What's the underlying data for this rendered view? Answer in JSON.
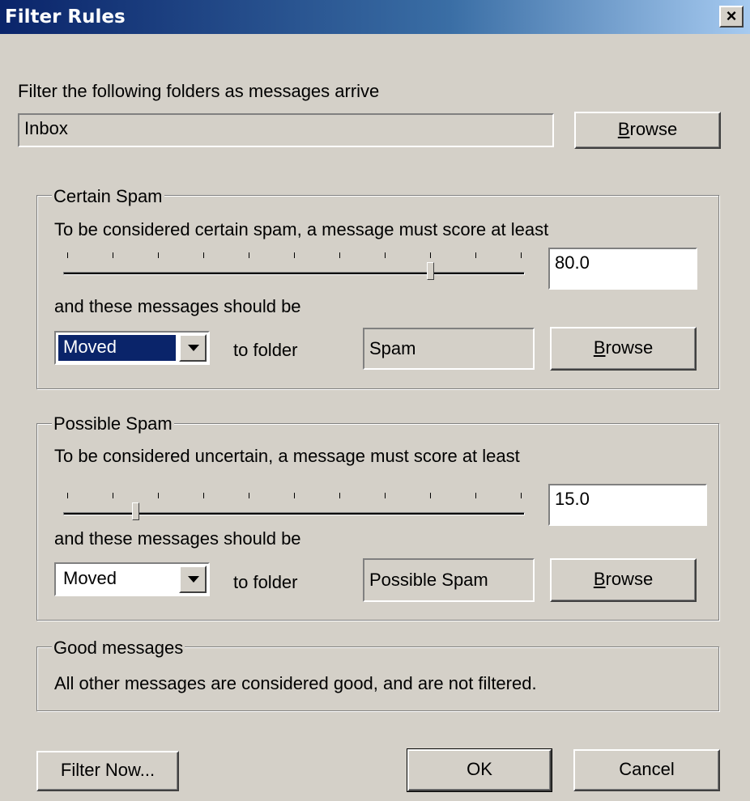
{
  "window": {
    "title": "Filter Rules",
    "close_label": "×"
  },
  "folders": {
    "instruction": "Filter the following folders as messages arrive",
    "value": "Inbox",
    "browse": {
      "prefix": "",
      "accel": "B",
      "rest": "rowse"
    }
  },
  "certain": {
    "group_label": "Certain Spam",
    "instruction": "To be considered certain spam, a message must score at least",
    "score": "80.0",
    "slider_level_percent": 80,
    "messages_label": "and these messages should be",
    "action": "Moved",
    "to_folder_label": "to folder",
    "folder": "Spam",
    "browse": {
      "accel": "B",
      "rest": "rowse"
    }
  },
  "possible": {
    "group_label": "Possible Spam",
    "instruction": "To be considered uncertain, a message must score at least",
    "score": "15.0",
    "slider_level_percent": 15,
    "messages_label": "and these messages should be",
    "action": "Moved",
    "to_folder_label": "to folder",
    "folder": "Possible Spam",
    "browse": {
      "accel": "B",
      "rest": "rowse"
    }
  },
  "good": {
    "group_label": "Good messages",
    "text": "All other messages are considered good, and are not filtered."
  },
  "footer": {
    "filter_now": "Filter Now...",
    "ok": "OK",
    "cancel": "Cancel"
  },
  "colors": {
    "face": "#d4d0c8",
    "title_start": "#0a246a",
    "selection": "#0a246a"
  }
}
